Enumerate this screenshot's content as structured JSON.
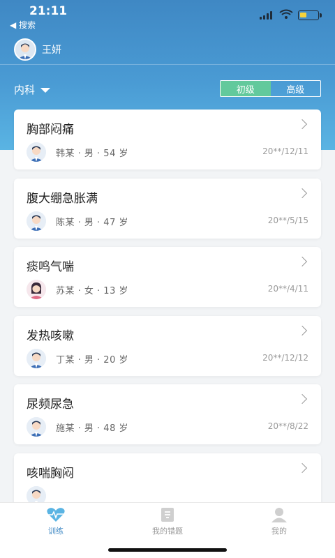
{
  "status_bar": {
    "time": "21:11",
    "back_label": "◀ 搜索"
  },
  "user": {
    "name": "王妍"
  },
  "department": {
    "label": "内科"
  },
  "level_tabs": [
    {
      "label": "初级",
      "active": true
    },
    {
      "label": "高级",
      "active": false
    }
  ],
  "cases": [
    {
      "title": "胸部闷痛",
      "patient": "韩某 · 男 · 54 岁",
      "date": "20**/12/11",
      "gender": "male"
    },
    {
      "title": "腹大绷急胀满",
      "patient": "陈某 · 男 · 47 岁",
      "date": "20**/5/15",
      "gender": "male"
    },
    {
      "title": "痰鸣气喘",
      "patient": "苏某 · 女 · 13 岁",
      "date": "20**/4/11",
      "gender": "female"
    },
    {
      "title": "发热咳嗽",
      "patient": "丁某 · 男 · 20 岁",
      "date": "20**/12/12",
      "gender": "male"
    },
    {
      "title": "尿频尿急",
      "patient": "施某 · 男 · 48 岁",
      "date": "20**/8/22",
      "gender": "male"
    },
    {
      "title": "咳喘胸闷",
      "patient": "",
      "date": "",
      "gender": "male"
    }
  ],
  "tabbar": [
    {
      "label": "训练",
      "icon": "heartbeat-icon",
      "active": true
    },
    {
      "label": "我的错题",
      "icon": "mistakes-icon",
      "active": false
    },
    {
      "label": "我的",
      "icon": "profile-icon",
      "active": false
    }
  ],
  "colors": {
    "header": "#3f88c4",
    "accent_green": "#62c99c"
  }
}
